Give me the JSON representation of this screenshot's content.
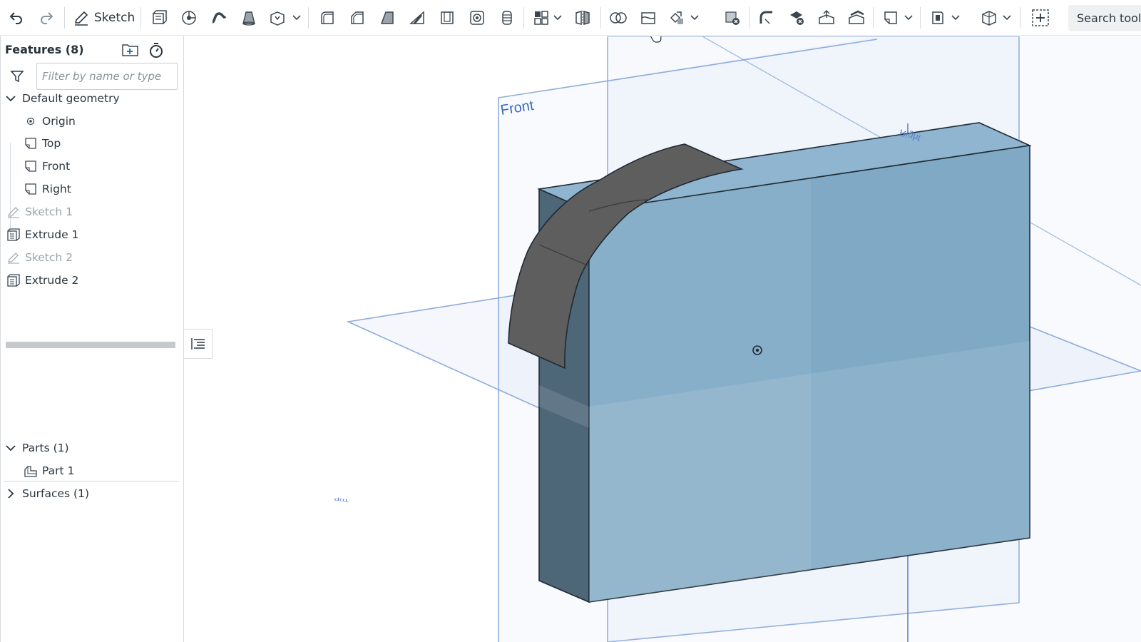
{
  "toolbar": {
    "undo_icon": "undo-icon",
    "redo_icon": "redo-icon",
    "sketch_label": "Sketch",
    "search_label": "Search tools"
  },
  "panel": {
    "title": "Features (8)",
    "filter_placeholder": "Filter by name or type",
    "default_geometry": {
      "label": "Default geometry",
      "items": [
        {
          "label": "Origin",
          "icon": "origin-icon"
        },
        {
          "label": "Top",
          "icon": "plane-icon"
        },
        {
          "label": "Front",
          "icon": "plane-icon"
        },
        {
          "label": "Right",
          "icon": "plane-icon"
        }
      ]
    },
    "features": [
      {
        "label": "Sketch 1",
        "icon": "sketch-icon",
        "suppressed_look": true
      },
      {
        "label": "Extrude 1",
        "icon": "extrude-icon",
        "suppressed_look": false
      },
      {
        "label": "Sketch 2",
        "icon": "sketch-icon",
        "suppressed_look": true
      },
      {
        "label": "Extrude 2",
        "icon": "extrude-icon",
        "suppressed_look": false
      }
    ],
    "parts_label": "Parts (1)",
    "parts": [
      {
        "label": "Part 1",
        "icon": "part-icon"
      }
    ],
    "surfaces_label": "Surfaces (1)"
  },
  "viewport": {
    "plane_labels": {
      "front": "Front",
      "top": "Top",
      "right": "Right"
    },
    "colors": {
      "part_face": "#7fa9c5",
      "part_side": "#4d6678",
      "surface": "#5e5e5e",
      "plane": "#7d9fd6"
    }
  }
}
